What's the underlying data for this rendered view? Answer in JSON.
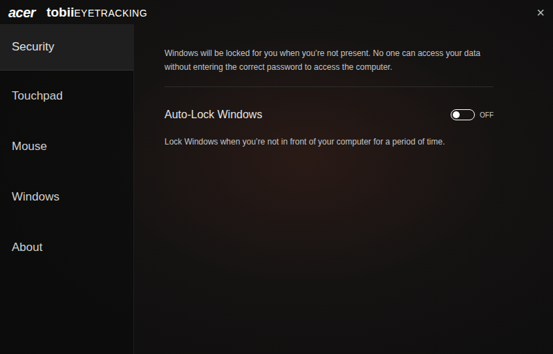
{
  "window": {
    "brand": "acer",
    "logo": {
      "name": "tobii",
      "suffix": "EYETRACKING"
    },
    "close": "×"
  },
  "sidebar": {
    "items": [
      {
        "label": "Security",
        "selected": true
      },
      {
        "label": "Touchpad",
        "selected": false
      },
      {
        "label": "Mouse",
        "selected": false
      },
      {
        "label": "Windows",
        "selected": false
      },
      {
        "label": "About",
        "selected": false
      }
    ]
  },
  "content": {
    "intro": "Windows will be locked for you when you’re not present. No one can access your data without entering the correct password to access the computer.",
    "settings": [
      {
        "title": "Auto-Lock Windows",
        "on": false,
        "state_label": "OFF",
        "description": "Lock Windows when you’re not in front of your computer for a period of time."
      }
    ]
  }
}
